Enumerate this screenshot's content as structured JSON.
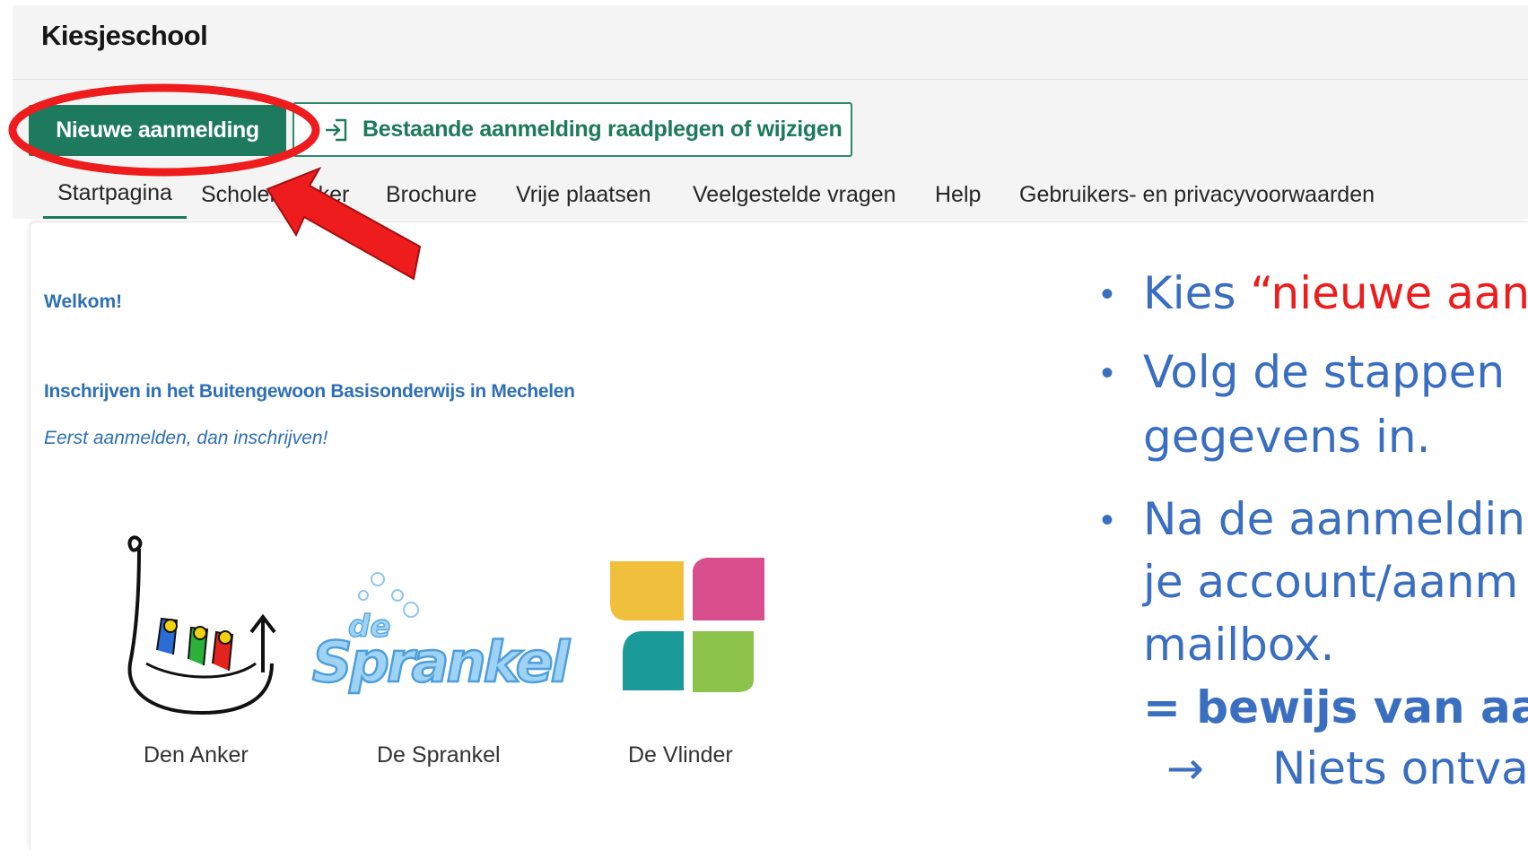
{
  "app": {
    "title": "Kiesjeschool"
  },
  "toolbar": {
    "new_label": "Nieuwe aanmelding",
    "existing_label": "Bestaande aanmelding raadplegen of wijzigen"
  },
  "nav": {
    "tabs": [
      {
        "label": "Startpagina",
        "active": true
      },
      {
        "label": "Scholenzoeker"
      },
      {
        "label": "Brochure"
      },
      {
        "label": "Vrije plaatsen"
      },
      {
        "label": "Veelgestelde vragen"
      },
      {
        "label": "Help"
      },
      {
        "label": "Gebruikers- en privacyvoorwaarden"
      }
    ]
  },
  "content": {
    "welcome": "Welkom!",
    "intro_title": "Inschrijven in het  Buitengewoon Basisonderwijs in Mechelen",
    "intro_subtitle": "Eerst aanmelden, dan inschrijven!",
    "schools": [
      {
        "name": "Den Anker"
      },
      {
        "name": "De Sprankel",
        "logo_text_top": "de",
        "logo_text_main": "Sprankel"
      },
      {
        "name": "De Vlinder"
      }
    ]
  },
  "annotation": {
    "b1_pre": "Kies ",
    "b1_red": "“nieuwe aan",
    "b2_line1": "Volg de stappen",
    "b2_line2": "gegevens in.",
    "b3_line1": "Na de aanmeldin",
    "b3_line2": "je account/aanm",
    "b3_line3": "mailbox.",
    "b3_bold": "= bewijs van aan",
    "arrow_glyph": "→",
    "b4": "Niets ontva",
    "highlight_color": "#ee1c1c"
  },
  "colors": {
    "accent": "#1d7a5c",
    "link": "#2f6fb6",
    "annotation_text": "#3a6ec0",
    "annotation_red": "#ee1c1c"
  }
}
